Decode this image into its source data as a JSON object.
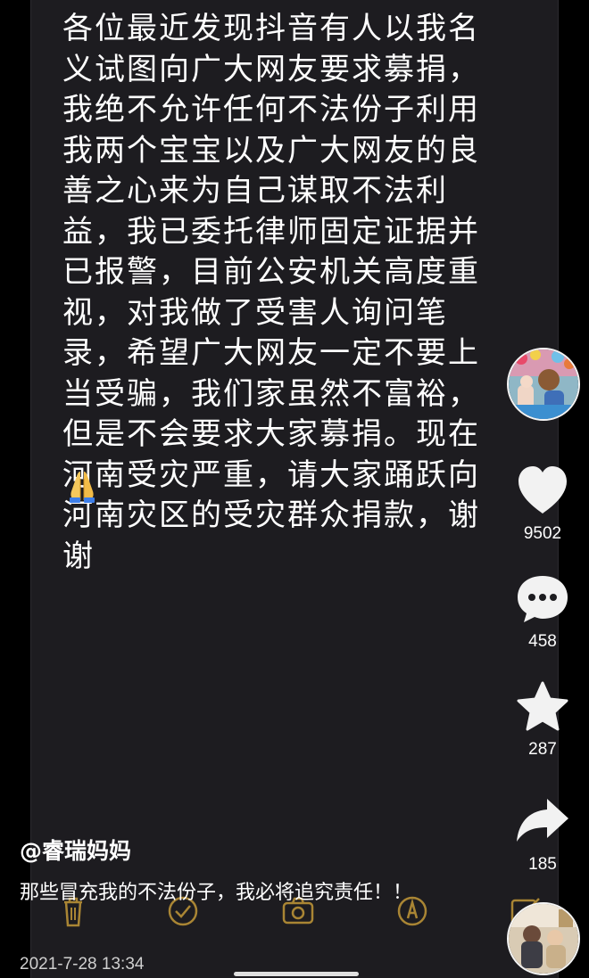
{
  "note": {
    "text": "各位最近发现抖音有人以我名义试图向广大网友要求募捐，我绝不允许任何不法份子利用我两个宝宝以及广大网友的良善之心来为自己谋取不法利益，我已委托律师固定证据并已报警，目前公安机关高度重视，对我做了受害人询问笔录，希望广大网友一定不要上当受骗，我们家虽然不富裕，但是不会要求大家募捐。现在河南受灾严重，请大家踊跃向河南灾区的受灾群众捐款，谢谢",
    "emoji": "folded-hands"
  },
  "actions": {
    "like_count": "9502",
    "comment_count": "458",
    "favorite_count": "287",
    "share_count": "185"
  },
  "post": {
    "username": "@睿瑞妈妈",
    "caption": "那些冒充我的不法份子，我必将追究责任！！",
    "date": "2021-7-28 13:34"
  },
  "colors": {
    "background": "#000000",
    "screen": "#1d1c20",
    "toolbar_accent": "#d8a93b"
  }
}
